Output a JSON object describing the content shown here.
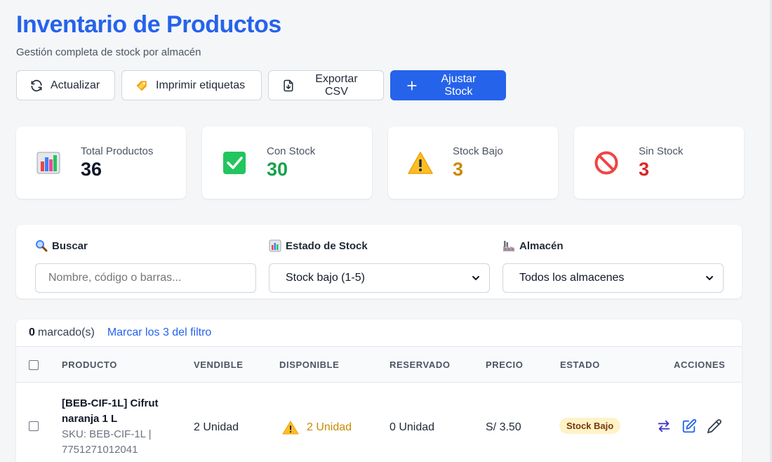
{
  "header": {
    "title": "Inventario de Productos",
    "subtitle": "Gestión completa de stock por almacén"
  },
  "toolbar": {
    "refresh_label": "Actualizar",
    "print_label": "Imprimir etiquetas",
    "export_label": "Exportar CSV",
    "adjust_label": "Ajustar Stock",
    "accent": "#2563eb"
  },
  "stats": [
    {
      "label": "Total Productos",
      "value": "36",
      "icon": "bar-chart-icon"
    },
    {
      "label": "Con Stock",
      "value": "30",
      "icon": "check-box-icon",
      "color": "#16a34a"
    },
    {
      "label": "Stock Bajo",
      "value": "3",
      "icon": "warning-icon",
      "color": "#ca8a04"
    },
    {
      "label": "Sin Stock",
      "value": "3",
      "icon": "prohibited-icon",
      "color": "#dc2626"
    }
  ],
  "filters": {
    "search": {
      "label": "Buscar",
      "placeholder": "Nombre, código o barras...",
      "value": ""
    },
    "status": {
      "label": "Estado de Stock",
      "value": "Stock bajo (1-5)"
    },
    "warehouse": {
      "label": "Almacén",
      "value": "Todos los almacenes"
    }
  },
  "selection": {
    "count": "0",
    "count_suffix": "marcado(s)",
    "mark_all_link": "Marcar los 3 del filtro"
  },
  "table": {
    "columns": [
      "PRODUCTO",
      "VENDIBLE",
      "DISPONIBLE",
      "RESERVADO",
      "PRECIO",
      "ESTADO",
      "ACCIONES"
    ],
    "rows": [
      {
        "name": "[BEB-CIF-1L] Cifrut naranja 1 L",
        "sku_line": "SKU: BEB-CIF-1L  |",
        "barcode": "7751271012041",
        "vendible": "2 Unidad",
        "disponible": "2 Unidad",
        "reservado": "0 Unidad",
        "precio": "S/ 3.50",
        "estado": "Stock Bajo"
      }
    ]
  }
}
